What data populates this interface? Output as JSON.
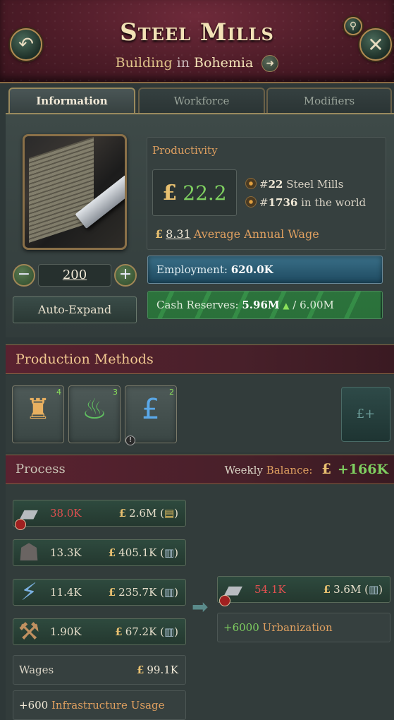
{
  "header": {
    "title": "Steel Mills",
    "subtitle_prefix": "Building",
    "subtitle_in": "in",
    "location": "Bohemia",
    "back_icon": "back-arrow-icon",
    "close_icon": "close-icon",
    "search_icon": "search-icon",
    "goto_icon": "arrow-right-icon"
  },
  "tabs": [
    {
      "label": "Information",
      "active": true
    },
    {
      "label": "Workforce",
      "active": false
    },
    {
      "label": "Modifiers",
      "active": false
    }
  ],
  "info": {
    "productivity_label": "Productivity",
    "productivity_currency": "£",
    "productivity_value": "22.2",
    "rank_building_prefix": "#",
    "rank_building_num": "22",
    "rank_building_label": "Steel Mills",
    "rank_world_prefix": "#",
    "rank_world_num": "1736",
    "rank_world_label": "in the world",
    "wage_currency": "£",
    "wage_value": "8.31",
    "wage_label": "Average Annual Wage",
    "level": "200",
    "auto_expand_label": "Auto-Expand",
    "employment_label": "Employment:",
    "employment_value": "620.0K",
    "employment_fill_fraction": 1.0,
    "cash_label": "Cash Reserves:",
    "cash_value": "5.96M",
    "cash_trend_icon": "up-triangle-icon",
    "cash_separator": "/",
    "cash_max": "6.00M",
    "cash_fill_fraction": 0.993
  },
  "production_methods": {
    "title": "Production Methods",
    "slots": [
      {
        "icon": "blast-furnace-icon",
        "glyph": "♜",
        "count": "4"
      },
      {
        "icon": "fire-gauge-icon",
        "glyph": "♨",
        "count": "3"
      },
      {
        "icon": "pound-hand-icon",
        "glyph": "£",
        "count": "2",
        "warning": "!"
      }
    ],
    "add_label": "£+"
  },
  "process": {
    "title": "Process",
    "weekly_label": "Weekly",
    "balance_label": "Balance:",
    "balance_currency": "£",
    "balance_value": "+166K",
    "inputs": [
      {
        "icon": "iron-icon",
        "glyph": "▰",
        "qty": "38.0K",
        "qty_color": "red",
        "currency": "£",
        "cost": "2.6M",
        "chip_open": "(",
        "chip": "▤",
        "chip_close": ")"
      },
      {
        "icon": "coal-icon",
        "glyph": "☗",
        "qty": "13.3K",
        "qty_color": "normal",
        "currency": "£",
        "cost": "405.1K",
        "chip_open": "(",
        "chip": "▥",
        "chip_close": ")"
      },
      {
        "icon": "electricity-icon",
        "glyph": "⚡",
        "qty": "11.4K",
        "qty_color": "normal",
        "currency": "£",
        "cost": "235.7K",
        "chip_open": "(",
        "chip": "▥",
        "chip_close": ")"
      },
      {
        "icon": "tools-icon",
        "glyph": "⚒",
        "qty": "1.90K",
        "qty_color": "normal",
        "currency": "£",
        "cost": "67.2K",
        "chip_open": "(",
        "chip": "▥",
        "chip_close": ")"
      }
    ],
    "output": {
      "icon": "steel-icon",
      "glyph": "▰",
      "qty": "54.1K",
      "currency": "£",
      "cost": "3.6M",
      "chip_open": "(",
      "chip": "▥",
      "chip_close": ")"
    },
    "urbanization_value": "+6000",
    "urbanization_label": "Urbanization",
    "wages_label": "Wages",
    "wages_currency": "£",
    "wages_value": "99.1K",
    "infra_value": "+600",
    "infra_label": "Infrastructure Usage"
  },
  "colors": {
    "header_bg": "#4e1c28",
    "panel_bg": "#323c3b",
    "positive": "#7fd060",
    "negative": "#e05050",
    "accent_orange": "#e0a060",
    "gold": "#e8c070"
  }
}
